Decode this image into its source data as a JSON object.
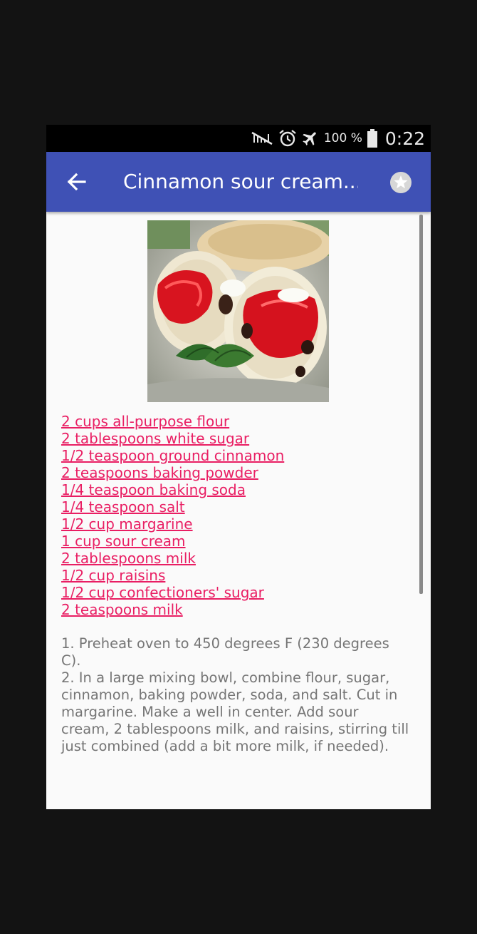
{
  "status_bar": {
    "battery_percent": "100 %",
    "time": "0:22",
    "icons": [
      "no-signal-icon",
      "alarm-icon",
      "airplane-mode-icon",
      "battery-icon"
    ]
  },
  "toolbar": {
    "title": "Cinnamon sour cream...",
    "back_icon": "arrow-left-icon",
    "favorite_icon": "star-icon",
    "color": "#3f51b5"
  },
  "recipe": {
    "image_icon": "scones-photo",
    "ingredients": [
      "2 cups all-purpose flour",
      "2 tablespoons white sugar",
      "1/2 teaspoon ground cinnamon",
      "2 teaspoons baking powder",
      "1/4 teaspoon baking soda",
      "1/4 teaspoon salt",
      "1/2 cup margarine",
      "1 cup sour cream",
      "2 tablespoons milk",
      "1/2 cup raisins",
      "1/2 cup confectioners' sugar",
      "2 teaspoons milk"
    ],
    "link_color": "#e91e63",
    "steps": [
      "1. Preheat oven to 450 degrees F (230 degrees C).",
      "2. In a large mixing bowl, combine flour, sugar, cinnamon, baking powder, soda, and salt. Cut in margarine. Make a well in center. Add sour cream, 2 tablespoons milk, and raisins, stirring till just combined (add a bit more milk, if needed)."
    ]
  }
}
